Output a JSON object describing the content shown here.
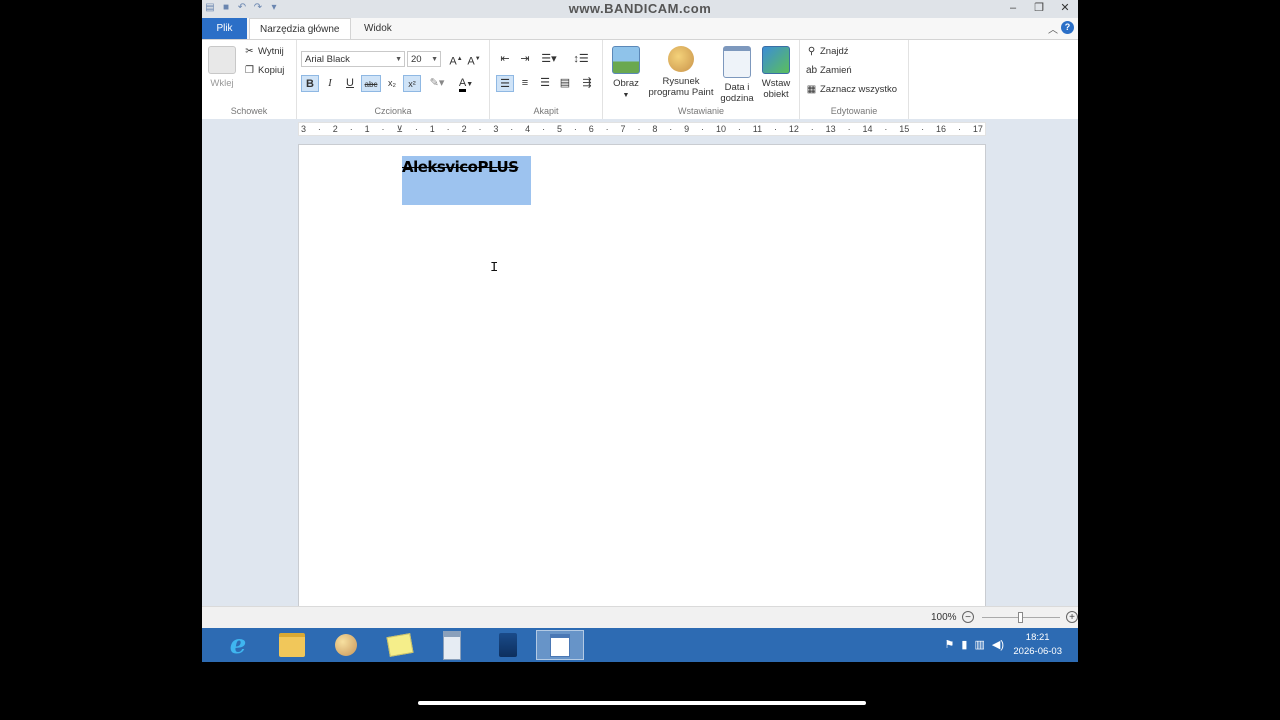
{
  "window": {
    "title": "www.BANDICAM.com",
    "minimize": "‒",
    "restore": "❐",
    "close": "✕"
  },
  "tabs": {
    "file": "Plik",
    "home": "Narzędzia główne",
    "view": "Widok"
  },
  "ribbon": {
    "clipboard": {
      "paste": "Wklej",
      "cut": "Wytnij",
      "copy": "Kopiuj",
      "label": "Schowek"
    },
    "font": {
      "family": "Arial Black",
      "size": "20",
      "label": "Czcionka",
      "bold": "B",
      "italic": "I",
      "underline": "U",
      "strikethrough": "abc",
      "subscript": "x₂",
      "superscript": "x²"
    },
    "paragraph": {
      "label": "Akapit"
    },
    "insert": {
      "picture": "Obraz",
      "paint_line1": "Rysunek",
      "paint_line2": "programu Paint",
      "datetime_line1": "Data i",
      "datetime_line2": "godzina",
      "object_line1": "Wstaw",
      "object_line2": "obiekt",
      "label": "Wstawianie"
    },
    "editing": {
      "find": "Znajdź",
      "replace": "Zamień",
      "select_all": "Zaznacz wszystko",
      "label": "Edytowanie"
    }
  },
  "ruler": {
    "ticks": [
      "3",
      "·",
      "2",
      "·",
      "1",
      "·",
      "",
      "·",
      "1",
      "·",
      "2",
      "·",
      "3",
      "·",
      "4",
      "·",
      "5",
      "·",
      "6",
      "·",
      "7",
      "·",
      "8",
      "·",
      "9",
      "·",
      "10",
      "·",
      "11",
      "·",
      "12",
      "·",
      "13",
      "·",
      "14",
      "·",
      "15",
      "·",
      "16",
      "·",
      "17"
    ]
  },
  "document": {
    "text": "AleksvicoPLUS"
  },
  "status": {
    "zoom": "100%",
    "zoom_level_percent": 100
  },
  "taskbar": {
    "time": "18:21",
    "date": "2026-06-03"
  },
  "colors": {
    "file_tab": "#2b6fc7",
    "selection": "#9dc3ef",
    "taskbar": "#2d6bb3"
  }
}
